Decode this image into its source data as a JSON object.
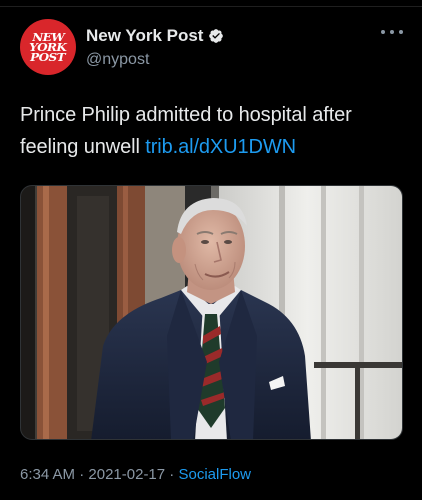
{
  "account": {
    "display_name": "New York Post",
    "handle": "@nypost",
    "avatar_lines": [
      "NEW",
      "YORK",
      "POST"
    ],
    "verified": true
  },
  "tweet": {
    "text": "Prince Philip admitted to hospital after feeling unwell ",
    "link": "trib.al/dXU1DWN"
  },
  "media": {
    "kind": "photo"
  },
  "meta": {
    "time": "6:34 AM",
    "separator": " · ",
    "date": "2021-02-17",
    "source": "SocialFlow"
  },
  "colors": {
    "background": "#000000",
    "text": "#e7e9ea",
    "secondary": "#8b98a5",
    "link": "#1d9bf0",
    "avatar": "#d9262b"
  },
  "icons": {
    "verified": "verified-badge-icon",
    "more": "more-options-icon"
  }
}
